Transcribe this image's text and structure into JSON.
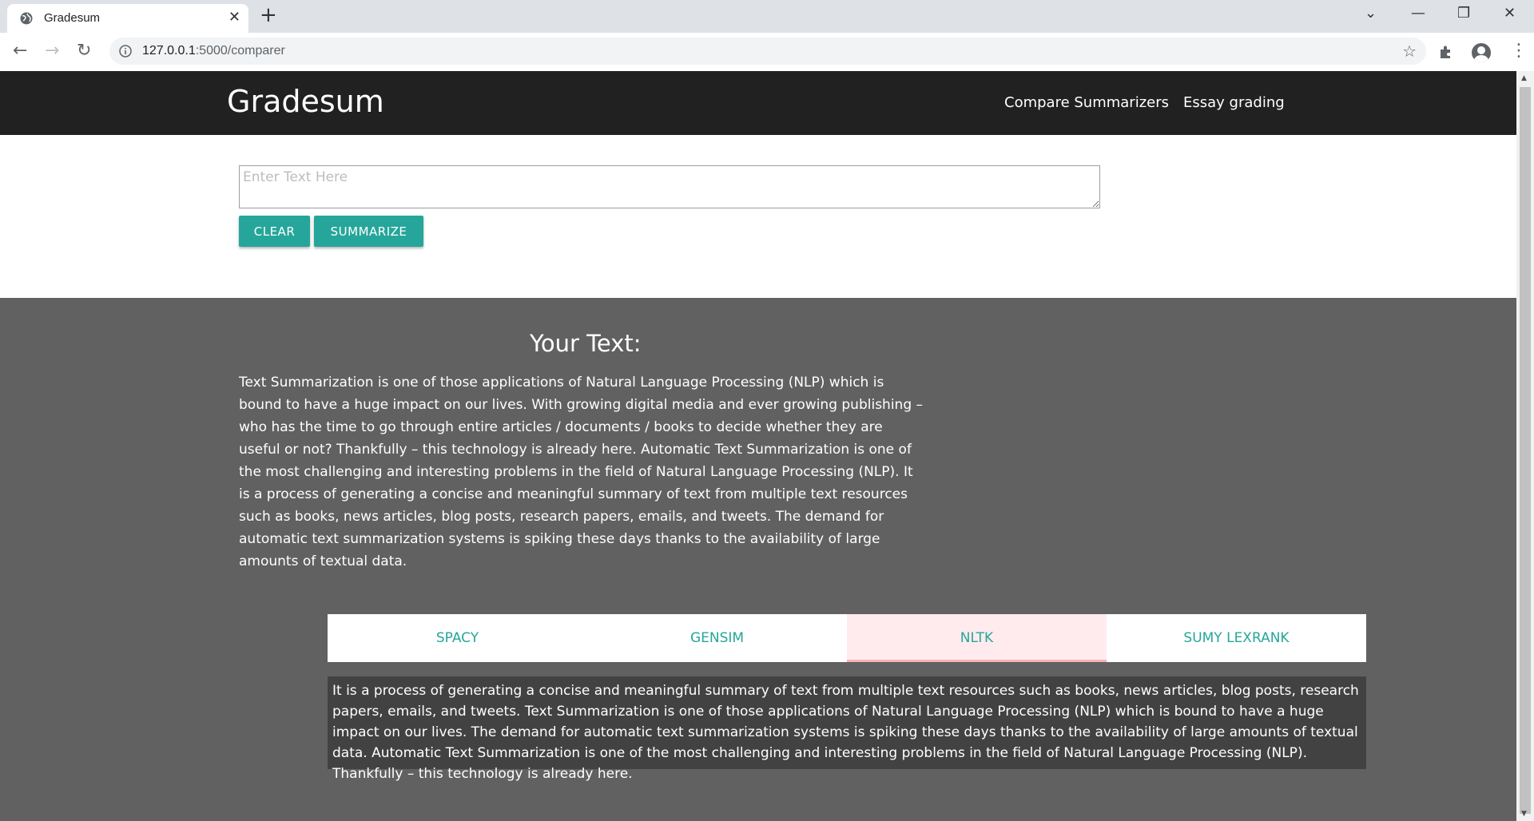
{
  "browser": {
    "tab_title": "Gradesum",
    "url_host": "127.0.0.1",
    "url_path": ":5000/comparer",
    "window_controls": [
      "⌄",
      "—",
      "❐",
      "✕"
    ]
  },
  "navbar": {
    "brand": "Gradesum",
    "links": [
      "Compare Summarizers",
      "Essay grading"
    ]
  },
  "input": {
    "placeholder": "Enter Text Here",
    "value": ""
  },
  "buttons": {
    "clear": "CLEAR",
    "summarize": "SUMMARIZE"
  },
  "your_text": {
    "title": "Your Text:",
    "body": "Text Summarization is one of those applications of Natural Language Processing (NLP) which is bound to have a huge impact on our lives. With growing digital media and ever growing publishing – who has the time to go through entire articles / documents / books to decide whether they are useful or not? Thankfully – this technology is already here. Automatic Text Summarization is one of the most challenging and interesting problems in the field of Natural Language Processing (NLP). It is a process of generating a concise and meaningful summary of text from multiple text resources such as books, news articles, blog posts, research papers, emails, and tweets. The demand for automatic text summarization systems is spiking these days thanks to the availability of large amounts of textual data."
  },
  "summarizer_tabs": {
    "items": [
      "SPACY",
      "GENSIM",
      "NLTK",
      "SUMY LEXRANK"
    ],
    "active": "NLTK"
  },
  "summary": {
    "text": "It is a process of generating a concise and meaningful summary of text from multiple text resources such as books, news articles, blog posts, research papers, emails, and tweets. Text Summarization is one of those applications of Natural Language Processing (NLP) which is bound to have a huge impact on our lives. The demand for automatic text summarization systems is spiking these days thanks to the availability of large amounts of textual data. Automatic Text Summarization is one of the most challenging and interesting problems in the field of Natural Language Processing (NLP). Thankfully – this technology is already here."
  },
  "colors": {
    "navbar": "#212121",
    "accent": "#26a69a",
    "page_bg": "#616161",
    "summary_bg": "#424242",
    "active_tab_bg": "#ffebee"
  }
}
